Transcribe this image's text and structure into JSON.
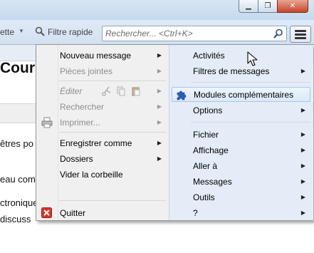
{
  "window": {
    "controls": [
      "minimize",
      "maximize",
      "close"
    ]
  },
  "toolbar": {
    "partial_left_label": "ette",
    "quick_filter_label": "Filtre rapide",
    "search_placeholder": "Rechercher... <Ctrl+K>"
  },
  "background": {
    "title": "Courr",
    "lines": [
      "êtres po",
      "eau com",
      "ctronique",
      "discuss"
    ]
  },
  "menu": {
    "left": [
      {
        "label": "Nouveau message",
        "submenu": true,
        "disabled": false
      },
      {
        "label": "Pièces jointes",
        "submenu": true,
        "disabled": true
      },
      {
        "label": "Éditer",
        "submenu": true,
        "disabled": true
      },
      {
        "label": "Rechercher",
        "submenu": true,
        "disabled": true
      },
      {
        "label": "Imprimer...",
        "submenu": true,
        "disabled": true
      },
      {
        "label": "Enregistrer comme",
        "submenu": true,
        "disabled": false
      },
      {
        "label": "Dossiers",
        "submenu": true,
        "disabled": false
      },
      {
        "label": "Vider la corbeille",
        "submenu": false,
        "disabled": false
      },
      {
        "label": "Quitter",
        "submenu": false,
        "disabled": false
      }
    ],
    "right": [
      {
        "label": "Activités",
        "submenu": false
      },
      {
        "label": "Filtres de messages",
        "submenu": true
      },
      {
        "label": "Modules complémentaires",
        "submenu": false,
        "highlighted": true
      },
      {
        "label": "Options",
        "submenu": true
      },
      {
        "label": "Fichier",
        "submenu": true
      },
      {
        "label": "Affichage",
        "submenu": true
      },
      {
        "label": "Aller à",
        "submenu": true
      },
      {
        "label": "Messages",
        "submenu": true
      },
      {
        "label": "Outils",
        "submenu": true
      },
      {
        "label": "?",
        "submenu": true
      }
    ]
  },
  "colors": {
    "accent": "#2b5fb4",
    "hover_border": "#a8c6ee",
    "quit_icon": "#d9342b"
  },
  "icons": [
    "search-icon",
    "printer-icon",
    "quit-icon",
    "puzzle-icon",
    "hamburger-menu-icon",
    "cut-icon",
    "copy-icon",
    "paste-icon"
  ]
}
